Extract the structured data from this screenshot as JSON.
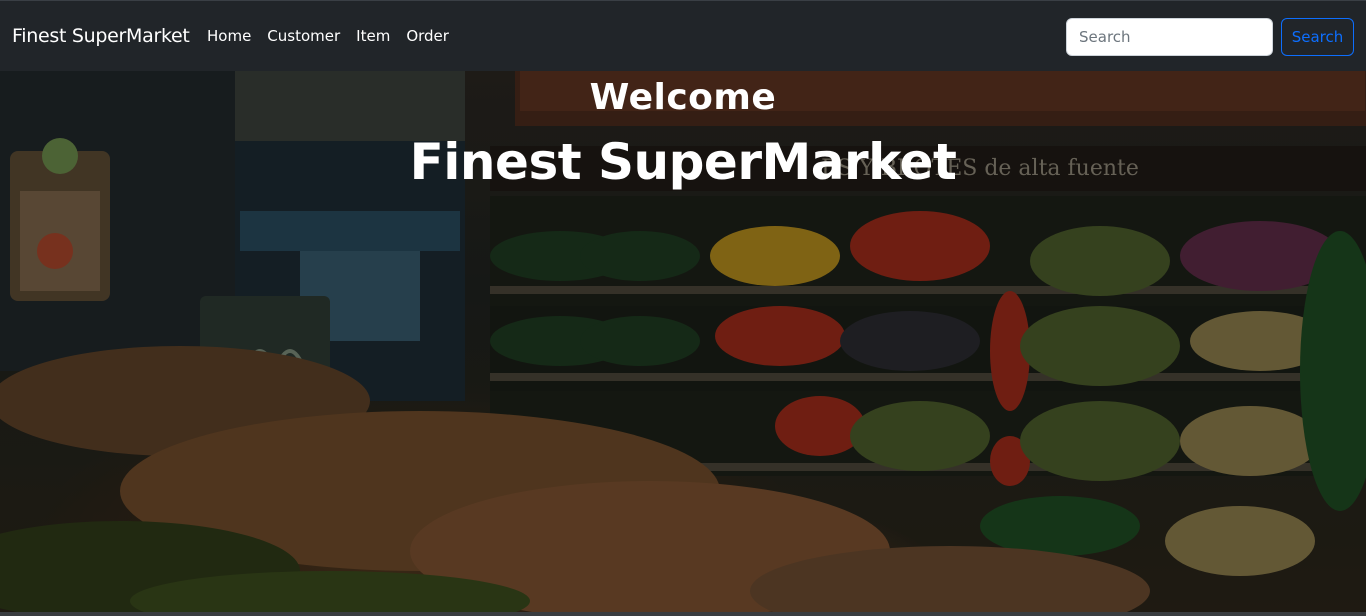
{
  "navbar": {
    "brand": "Finest SuperMarket",
    "links": [
      {
        "label": "Home"
      },
      {
        "label": "Customer"
      },
      {
        "label": "Item"
      },
      {
        "label": "Order"
      }
    ],
    "search": {
      "placeholder": "Search",
      "value": "",
      "button_label": "Search"
    }
  },
  "hero": {
    "welcome": "Welcome",
    "title": "Finest SuperMarket",
    "background_image": "supermarket-produce-photo"
  },
  "colors": {
    "navbar_bg": "#212529",
    "search_button": "#0d6efd",
    "text": "#ffffff"
  }
}
